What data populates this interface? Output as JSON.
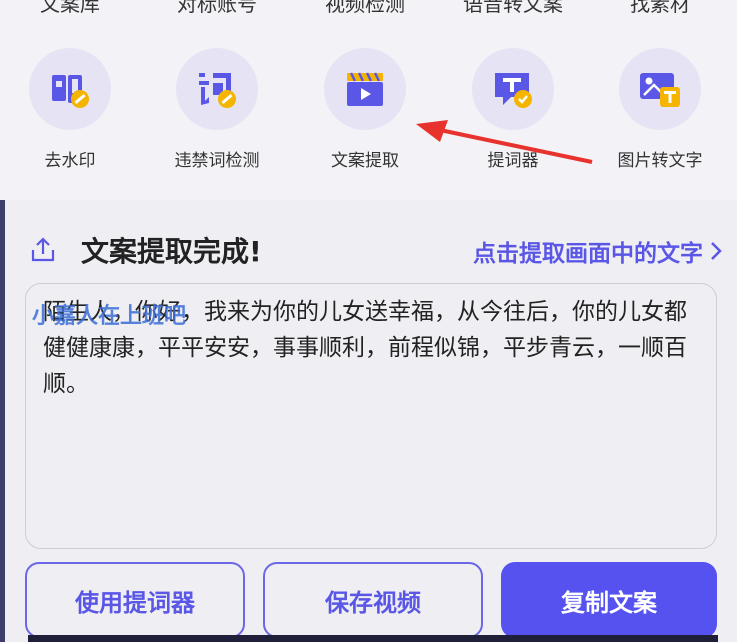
{
  "top_labels": [
    "文案库",
    "对标账号",
    "视频检测",
    "语音转文案",
    "找素材"
  ],
  "tools": [
    {
      "label": "去水印",
      "icon": "watermark-remove-icon"
    },
    {
      "label": "违禁词检测",
      "icon": "forbidden-word-check-icon"
    },
    {
      "label": "文案提取",
      "icon": "video-clapper-icon"
    },
    {
      "label": "提词器",
      "icon": "teleprompter-icon"
    },
    {
      "label": "图片转文字",
      "icon": "image-to-text-icon"
    }
  ],
  "result": {
    "title": "文案提取完成!",
    "link": "点击提取画面中的文字",
    "watermark": "小嘉人在上班吧",
    "text": "陌生人，你好，我来为你的儿女送幸福，从今往后，你的儿女都健健康康，平平安安，事事顺利，前程似锦，平步青云，一顺百顺。"
  },
  "buttons": {
    "teleprompter": "使用提词器",
    "save_video": "保存视频",
    "copy_text": "复制文案"
  },
  "colors": {
    "accent": "#5652f0",
    "annotation_arrow": "#e8322e"
  }
}
